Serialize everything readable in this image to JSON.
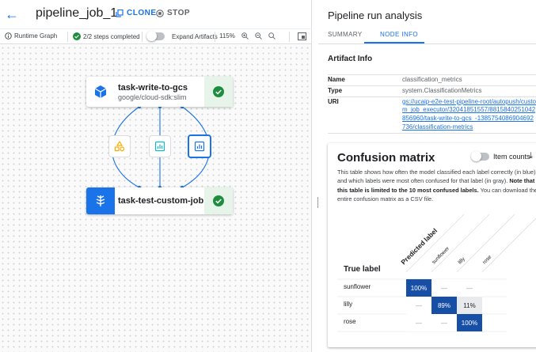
{
  "header": {
    "job_name": "pipeline_job_1",
    "clone_label": "CLONE",
    "stop_label": "STOP"
  },
  "toolbar": {
    "runtime_graph": "Runtime Graph",
    "steps_completed": "2/2 steps completed",
    "expand_artifacts": "Expand Artifacts",
    "zoom_level": "115%"
  },
  "graph": {
    "node_top": {
      "name": "task-write-to-gcs",
      "image": "google/cloud-sdk:slim",
      "status": "succeeded"
    },
    "node_bottom": {
      "name": "task-test-custom-job",
      "status": "succeeded"
    },
    "artifacts": [
      {
        "icon": "dataset-icon",
        "color": "#f9ab00"
      },
      {
        "icon": "metrics-icon",
        "color": "#12b5cb"
      },
      {
        "icon": "classification-metrics-icon",
        "color": "#1a73e8",
        "selected": true
      }
    ]
  },
  "panel": {
    "title": "Pipeline run analysis",
    "tabs": [
      {
        "label": "SUMMARY"
      },
      {
        "label": "NODE INFO",
        "active": true
      }
    ],
    "artifact_info_title": "Artifact Info",
    "info": [
      {
        "key": "Name",
        "value": "classification_metrics"
      },
      {
        "key": "Type",
        "value": "system.ClassificationMetrics"
      },
      {
        "key": "URI",
        "value": "gs://ucaip-e2e-test-pipeline-root/autopush/custom_job_executor/32041851557/8815840251042856960/task-write-to-gcs_-1385754086904692736/classification-metrics"
      }
    ]
  },
  "confusion": {
    "title": "Confusion matrix",
    "toggle_label": "Item counts",
    "desc_1": "This table shows how often the model classified each label correctly (in blue), and which labels were most often confused for that label (in gray).",
    "desc_bold": "Note that this table is limited to the 10 most confused labels.",
    "desc_2": "You can download the entire confusion matrix as a CSV file.",
    "predicted_label": "Predicted label",
    "true_label": "True label",
    "labels": [
      "sunflower",
      "lilly",
      "rose"
    ],
    "cells": [
      [
        "100%",
        "—",
        "—"
      ],
      [
        "—",
        "89%",
        "11%"
      ],
      [
        "—",
        "—",
        "100%"
      ]
    ],
    "colors": {
      "correct": "#174ea6",
      "confused": "#e8eaed",
      "empty": "#ffffff"
    }
  },
  "colors": {
    "accent": "#1a73e8",
    "success": "#1e8e3e",
    "success_bg": "#e6f4ea"
  }
}
